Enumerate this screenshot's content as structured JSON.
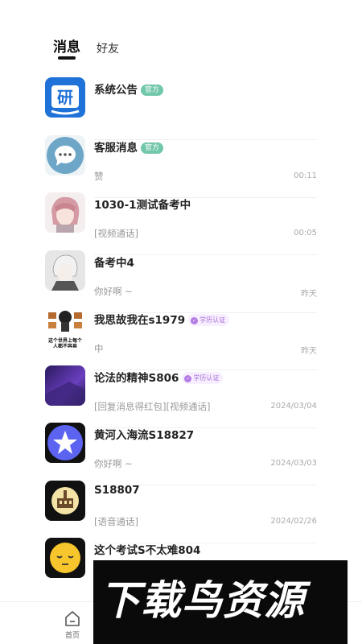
{
  "tabs": {
    "messages": "消息",
    "friends": "好友"
  },
  "conversations": [
    {
      "name": "系统公告",
      "badge": "官方",
      "preview": "",
      "time": "",
      "avatar": "yan-logo-icon"
    },
    {
      "name": "客服消息",
      "badge": "官方",
      "preview": "赞",
      "time": "00:11",
      "avatar": "chat-bubble-icon"
    },
    {
      "name": "1030-1测试备考中",
      "badge": "",
      "preview": "[视频通话]",
      "time": "00:05",
      "avatar": "anime-avatar"
    },
    {
      "name": "备考中4",
      "badge": "",
      "preview": "你好啊 ~",
      "time": "昨天",
      "avatar": "anime-avatar-gray"
    },
    {
      "name": "我思故我在s1979",
      "cert": "学历认证",
      "preview": "中",
      "time": "昨天",
      "avatar": "meme-avatar",
      "avatar_text": "这个世界上每个人都不容易"
    },
    {
      "name": "论法的精神S806",
      "cert": "学历认证",
      "preview": "[回复消息得红包][视频通话]",
      "time": "2024/03/04",
      "avatar": "purple-abstract-avatar"
    },
    {
      "name": "黄河入海流S18827",
      "badge": "",
      "preview": "你好啊 ~",
      "time": "2024/03/03",
      "avatar": "star-icon"
    },
    {
      "name": "S18807",
      "badge": "",
      "preview": "[语音通话]",
      "time": "2024/02/26",
      "avatar": "building-avatar"
    },
    {
      "name": "这个考试S不太难804",
      "badge": "",
      "preview": "",
      "time": "",
      "avatar": "sleepy-face-icon"
    }
  ],
  "bottom_nav": {
    "home_label": "首页"
  },
  "watermark": {
    "text": "下载鸟资源"
  },
  "colors": {
    "official_badge": "#71c7a9",
    "cert_badge": "#b27ae3",
    "logo_blue": "#1f72d8",
    "star_circle": "#5b63f0"
  }
}
